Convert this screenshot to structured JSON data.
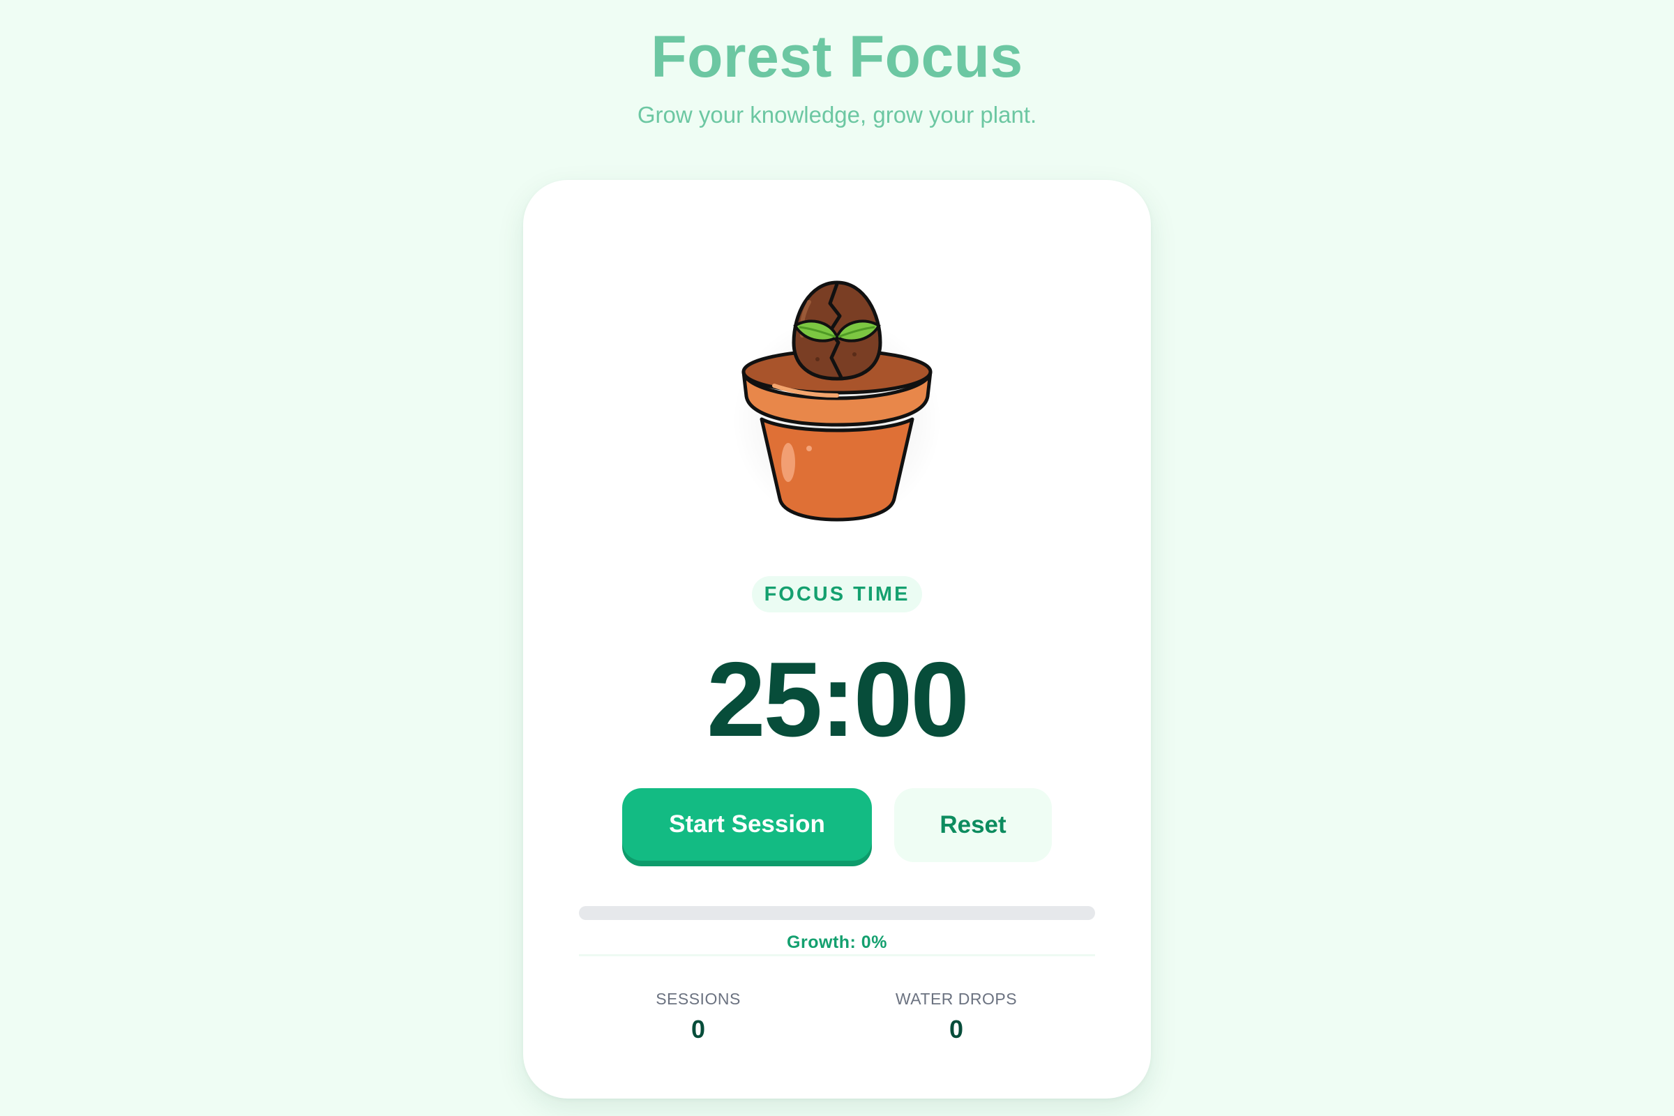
{
  "header": {
    "title": "Forest Focus",
    "subtitle": "Grow your knowledge, grow your plant."
  },
  "plant": {
    "icon": "seed-pot-icon"
  },
  "timer": {
    "mode_label": "FOCUS TIME",
    "display": "25:00"
  },
  "controls": {
    "start_label": "Start Session",
    "reset_label": "Reset"
  },
  "growth": {
    "percent": 0,
    "label": "Growth: 0%"
  },
  "stats": {
    "sessions_label": "SESSIONS",
    "sessions_value": "0",
    "water_label": "WATER DROPS",
    "water_value": "0"
  },
  "colors": {
    "background": "#effdf4",
    "accent": "#13bb83",
    "title": "#6cc7a2",
    "timer_text": "#074d3a"
  }
}
